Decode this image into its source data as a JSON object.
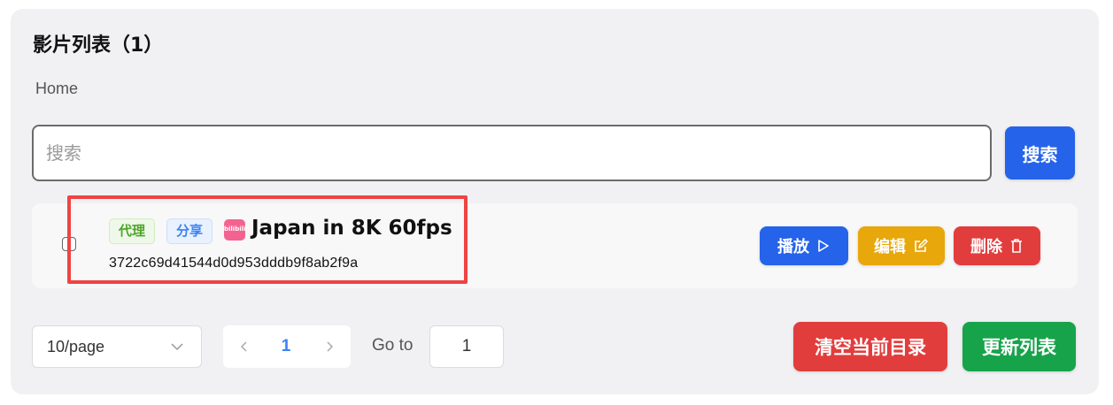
{
  "header": {
    "title": "影片列表（1）"
  },
  "breadcrumb": {
    "current": "Home"
  },
  "search": {
    "placeholder": "搜索",
    "value": "",
    "button_label": "搜索"
  },
  "videos": [
    {
      "tags": [
        "代理",
        "分享"
      ],
      "source_icon": "bilibili-icon",
      "source_icon_text": "bilibili",
      "title": "Japan in 8K 60fps",
      "hash": "3722c69d41544d0d953dddb9f8ab2f9a",
      "actions": {
        "play": "播放",
        "edit": "编辑",
        "delete": "删除"
      },
      "checked": false
    }
  ],
  "pagination": {
    "page_size": "10/page",
    "current_page": "1",
    "goto_label": "Go to",
    "goto_value": "1"
  },
  "footer": {
    "clear_label": "清空当前目录",
    "refresh_label": "更新列表"
  },
  "colors": {
    "primary": "#2563eb",
    "warning": "#e8a70a",
    "danger": "#e23d3d",
    "success": "#17a34a",
    "highlight": "#ef4444"
  }
}
